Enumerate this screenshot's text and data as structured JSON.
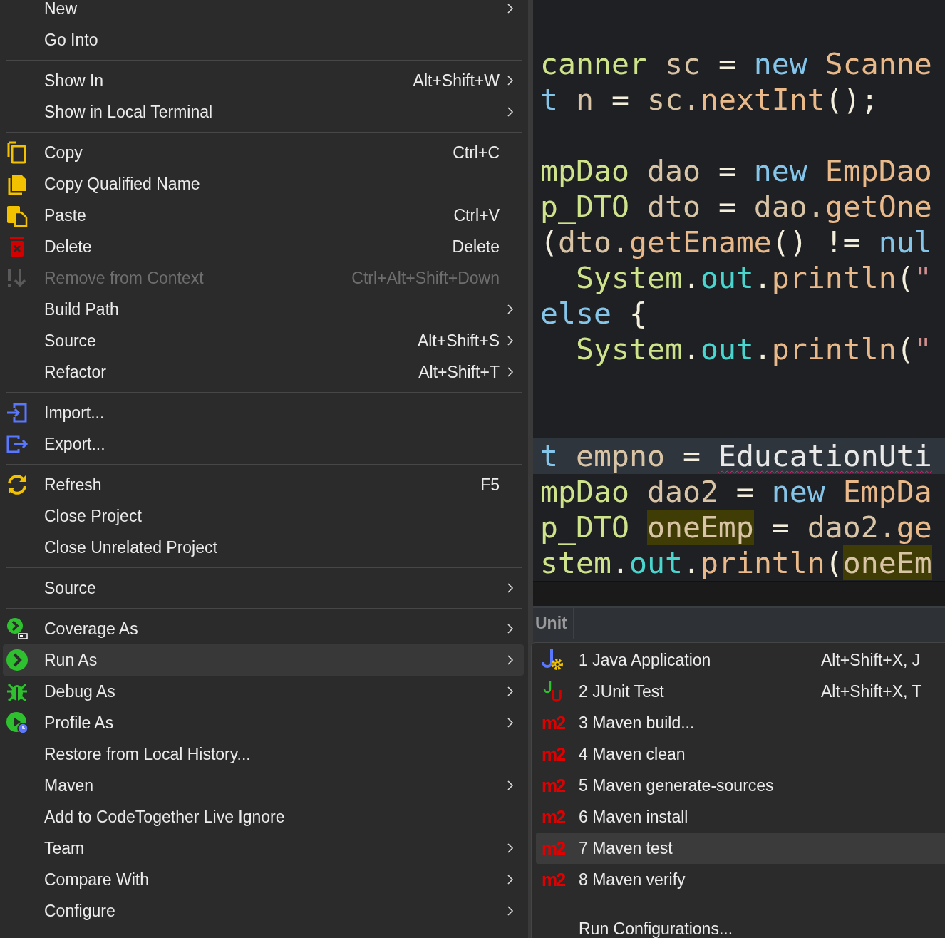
{
  "editor": {
    "blocks": [
      [
        {
          "current": false,
          "tokens": [
            {
              "text": "canner",
              "kind": "type"
            },
            {
              "text": " sc ",
              "kind": "ident"
            },
            {
              "text": "= ",
              "kind": "punct"
            },
            {
              "text": "new",
              "kind": "kw"
            },
            {
              "text": " Scanne",
              "kind": "method"
            }
          ]
        },
        {
          "current": false,
          "tokens": [
            {
              "text": "t",
              "kind": "kw"
            },
            {
              "text": " n ",
              "kind": "ident"
            },
            {
              "text": "= ",
              "kind": "punct"
            },
            {
              "text": "sc.",
              "kind": "ident"
            },
            {
              "text": "nextInt",
              "kind": "method"
            },
            {
              "text": "();",
              "kind": "punct"
            }
          ]
        }
      ],
      [
        {
          "current": false,
          "tokens": [
            {
              "text": "mpDao",
              "kind": "type"
            },
            {
              "text": " dao ",
              "kind": "ident"
            },
            {
              "text": "= ",
              "kind": "punct"
            },
            {
              "text": "new",
              "kind": "kw"
            },
            {
              "text": " EmpDao",
              "kind": "method"
            }
          ]
        },
        {
          "current": false,
          "tokens": [
            {
              "text": "p_DTO",
              "kind": "type"
            },
            {
              "text": " dto ",
              "kind": "ident"
            },
            {
              "text": "= ",
              "kind": "punct"
            },
            {
              "text": "dao.",
              "kind": "ident"
            },
            {
              "text": "getOne",
              "kind": "method"
            }
          ]
        },
        {
          "current": false,
          "tokens": [
            {
              "text": "(",
              "kind": "punct"
            },
            {
              "text": "dto.",
              "kind": "ident"
            },
            {
              "text": "getEname",
              "kind": "method"
            },
            {
              "text": "() != ",
              "kind": "punct"
            },
            {
              "text": "nul",
              "kind": "kw"
            }
          ]
        },
        {
          "current": false,
          "tokens": [
            {
              "text": "  System",
              "kind": "type"
            },
            {
              "text": ".",
              "kind": "punct"
            },
            {
              "text": "out",
              "kind": "field"
            },
            {
              "text": ".",
              "kind": "punct"
            },
            {
              "text": "println",
              "kind": "method"
            },
            {
              "text": "(",
              "kind": "punct"
            },
            {
              "text": "\"",
              "kind": "string"
            }
          ]
        },
        {
          "current": false,
          "tokens": [
            {
              "text": "else",
              "kind": "kw"
            },
            {
              "text": " {",
              "kind": "punct"
            }
          ]
        },
        {
          "current": false,
          "tokens": [
            {
              "text": "  System",
              "kind": "type"
            },
            {
              "text": ".",
              "kind": "punct"
            },
            {
              "text": "out",
              "kind": "field"
            },
            {
              "text": ".",
              "kind": "punct"
            },
            {
              "text": "println",
              "kind": "method"
            },
            {
              "text": "(",
              "kind": "punct"
            },
            {
              "text": "\"",
              "kind": "string"
            }
          ]
        }
      ],
      [
        {
          "current": true,
          "tokens": [
            {
              "text": "t",
              "kind": "kw"
            },
            {
              "text": " empno ",
              "kind": "ident"
            },
            {
              "text": "= ",
              "kind": "punct"
            },
            {
              "text": "EducationUti",
              "kind": "error"
            }
          ]
        },
        {
          "current": false,
          "tokens": [
            {
              "text": "mpDao",
              "kind": "type"
            },
            {
              "text": " dao2 ",
              "kind": "ident"
            },
            {
              "text": "= ",
              "kind": "punct"
            },
            {
              "text": "new",
              "kind": "kw"
            },
            {
              "text": " EmpDa",
              "kind": "method"
            }
          ]
        },
        {
          "current": false,
          "tokens": [
            {
              "text": "p_DTO ",
              "kind": "type"
            },
            {
              "text": "oneEmp",
              "kind": "occurrence"
            },
            {
              "text": " = ",
              "kind": "punct"
            },
            {
              "text": "dao2.",
              "kind": "ident"
            },
            {
              "text": "ge",
              "kind": "method"
            }
          ]
        },
        {
          "current": false,
          "tokens": [
            {
              "text": "stem",
              "kind": "type"
            },
            {
              "text": ".",
              "kind": "punct"
            },
            {
              "text": "out",
              "kind": "field"
            },
            {
              "text": ".",
              "kind": "punct"
            },
            {
              "text": "println",
              "kind": "method"
            },
            {
              "text": "(",
              "kind": "punct"
            },
            {
              "text": "oneEm",
              "kind": "occurrence"
            }
          ]
        }
      ]
    ]
  },
  "panel": {
    "tab": "Unit"
  },
  "context_menu": {
    "sections": [
      [
        {
          "label": "New",
          "submenu": true,
          "disabled": false,
          "selected": false
        },
        {
          "label": "Go Into",
          "submenu": false,
          "disabled": false,
          "selected": false
        }
      ],
      [
        {
          "label": "Show In",
          "shortcut": "Alt+Shift+W",
          "submenu": true,
          "disabled": false,
          "selected": false
        },
        {
          "label": "Show in Local Terminal",
          "submenu": true,
          "disabled": false,
          "selected": false
        }
      ],
      [
        {
          "label": "Copy",
          "shortcut": "Ctrl+C",
          "kind": "copy",
          "submenu": false,
          "disabled": false,
          "selected": false
        },
        {
          "label": "Copy Qualified Name",
          "kind": "copy-name",
          "submenu": false,
          "disabled": false,
          "selected": false
        },
        {
          "label": "Paste",
          "shortcut": "Ctrl+V",
          "kind": "paste",
          "submenu": false,
          "disabled": false,
          "selected": false
        },
        {
          "label": "Delete",
          "shortcut": "Delete",
          "kind": "delete",
          "submenu": false,
          "disabled": false,
          "selected": false
        },
        {
          "label": "Remove from Context",
          "shortcut": "Ctrl+Alt+Shift+Down",
          "kind": "remove",
          "submenu": false,
          "disabled": true,
          "selected": false
        },
        {
          "label": "Build Path",
          "submenu": true,
          "disabled": false,
          "selected": false
        },
        {
          "label": "Source",
          "shortcut": "Alt+Shift+S",
          "submenu": true,
          "disabled": false,
          "selected": false
        },
        {
          "label": "Refactor",
          "shortcut": "Alt+Shift+T",
          "submenu": true,
          "disabled": false,
          "selected": false
        }
      ],
      [
        {
          "label": "Import...",
          "kind": "import",
          "submenu": false,
          "disabled": false,
          "selected": false
        },
        {
          "label": "Export...",
          "kind": "export",
          "submenu": false,
          "disabled": false,
          "selected": false
        }
      ],
      [
        {
          "label": "Refresh",
          "shortcut": "F5",
          "kind": "refresh",
          "submenu": false,
          "disabled": false,
          "selected": false
        },
        {
          "label": "Close Project",
          "submenu": false,
          "disabled": false,
          "selected": false
        },
        {
          "label": "Close Unrelated Project",
          "submenu": false,
          "disabled": false,
          "selected": false
        }
      ],
      [
        {
          "label": "Source",
          "submenu": true,
          "disabled": false,
          "selected": false
        }
      ],
      [
        {
          "label": "Coverage As",
          "kind": "coverage",
          "submenu": true,
          "disabled": false,
          "selected": false
        },
        {
          "label": "Run As",
          "kind": "run",
          "submenu": true,
          "disabled": false,
          "selected": true
        },
        {
          "label": "Debug As",
          "kind": "debug",
          "submenu": true,
          "disabled": false,
          "selected": false
        },
        {
          "label": "Profile As",
          "kind": "profile",
          "submenu": true,
          "disabled": false,
          "selected": false
        },
        {
          "label": "Restore from Local History...",
          "submenu": false,
          "disabled": false,
          "selected": false
        },
        {
          "label": "Maven",
          "submenu": true,
          "disabled": false,
          "selected": false
        },
        {
          "label": "Add to CodeTogether Live Ignore",
          "submenu": false,
          "disabled": false,
          "selected": false
        },
        {
          "label": "Team",
          "submenu": true,
          "disabled": false,
          "selected": false
        },
        {
          "label": "Compare With",
          "submenu": true,
          "disabled": false,
          "selected": false
        },
        {
          "label": "Configure",
          "submenu": true,
          "disabled": false,
          "selected": false
        }
      ]
    ]
  },
  "run_as_menu": {
    "sections": [
      [
        {
          "label": "1 Java Application",
          "shortcut": "Alt+Shift+X, J",
          "kind": "java",
          "selected": false
        },
        {
          "label": "2 JUnit Test",
          "shortcut": "Alt+Shift+X, T",
          "kind": "junit",
          "selected": false
        },
        {
          "label": "3 Maven build...",
          "kind": "maven",
          "badge": "m2",
          "selected": false
        },
        {
          "label": "4 Maven clean",
          "kind": "maven",
          "badge": "m2",
          "selected": false
        },
        {
          "label": "5 Maven generate-sources",
          "kind": "maven",
          "badge": "m2",
          "selected": false
        },
        {
          "label": "6 Maven install",
          "kind": "maven",
          "badge": "m2",
          "selected": false
        },
        {
          "label": "7 Maven test",
          "kind": "maven",
          "badge": "m2",
          "selected": true
        },
        {
          "label": "8 Maven verify",
          "kind": "maven",
          "badge": "m2",
          "selected": false
        }
      ],
      [
        {
          "label": "Run Configurations...",
          "selected": false
        }
      ]
    ]
  }
}
